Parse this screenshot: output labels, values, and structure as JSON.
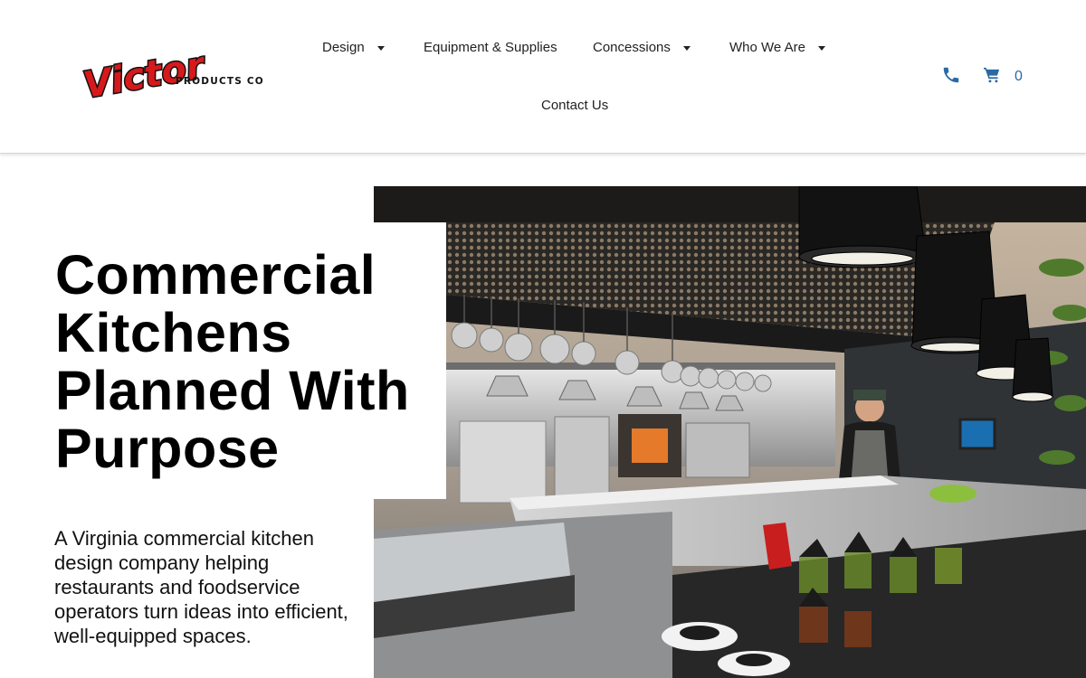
{
  "brand": {
    "logo_word": "Victor",
    "logo_tagline": "PRODUCTS CO.",
    "logo_color": "#d7191c"
  },
  "nav": {
    "design": "Design",
    "equipment": "Equipment & Supplies",
    "concessions": "Concessions",
    "who_we_are": "Who We Are",
    "contact": "Contact Us"
  },
  "utilities": {
    "phone_icon": "phone-icon",
    "cart_icon": "cart-icon",
    "cart_count": "0",
    "accent_color": "#2b6aa3"
  },
  "hero": {
    "title": "Commercial Kitchens Planned With Purpose",
    "description": "A Virginia commercial kitchen design company helping restaurants and foodservice operators turn ideas into efficient, well-equipped spaces.",
    "image_alt": "commercial-kitchen-photo"
  }
}
